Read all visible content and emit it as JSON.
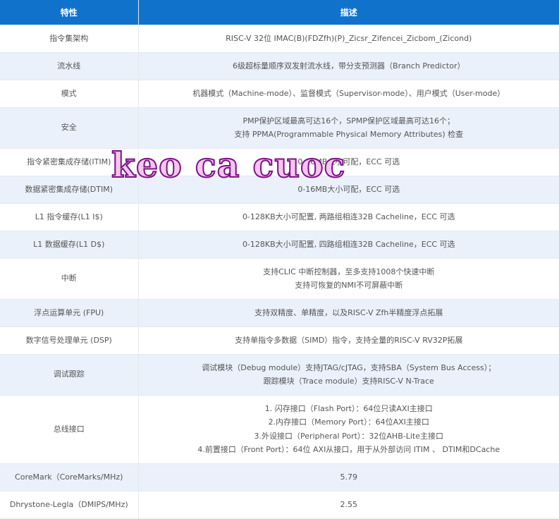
{
  "table": {
    "header": {
      "feature": "特性",
      "description": "描述"
    },
    "rows": [
      {
        "feature": "指令集架构",
        "lines": [
          "RISC-V 32位 IMAC(B)(FDZfh)(P)_Zicsr_Zifencei_Zicbom_(Zicond)"
        ]
      },
      {
        "feature": "流水线",
        "lines": [
          "6级超标量顺序双发射流水线，带分支预测器（Branch Predictor）"
        ]
      },
      {
        "feature": "模式",
        "lines": [
          "机器模式（Machine-mode）、监督模式（Supervisor-mode）、用户模式（User-mode）"
        ]
      },
      {
        "feature": "安全",
        "lines": [
          "PMP保护区域最高可达16个，SPMP保护区域最高可达16个；",
          "支持 PPMA(Programmable Physical Memory Attributes) 检查"
        ]
      },
      {
        "feature": "指令紧密集成存储(ITIM)",
        "lines": [
          "0-16MB大小可配，ECC 可选"
        ]
      },
      {
        "feature": "数据紧密集成存储(DTIM)",
        "lines": [
          "0-16MB大小可配，ECC 可选"
        ]
      },
      {
        "feature": "L1 指令缓存(L1 I$)",
        "lines": [
          "0-128KB大小可配置, 两路组相连32B Cacheline，ECC 可选"
        ]
      },
      {
        "feature": "L1 数据缓存(L1 D$)",
        "lines": [
          "0-128KB大小可配置, 四路组相连32B Cacheline，ECC 可选"
        ]
      },
      {
        "feature": "中断",
        "lines": [
          "支持CLIC 中断控制器，至多支持1008个快速中断",
          "支持可恢复的NMI不可屏蔽中断"
        ]
      },
      {
        "feature": "浮点运算单元 (FPU)",
        "lines": [
          "支持双精度、单精度，以及RISC-V Zfh半精度浮点拓展"
        ]
      },
      {
        "feature": "数字信号处理单元 (DSP)",
        "lines": [
          "支持单指令多数据（SIMD）指令，支持全量的RISC-V RV32P拓展"
        ]
      },
      {
        "feature": "调试跟踪",
        "lines": [
          "调试模块（Debug module）支持JTAG/cJTAG，支持SBA（System Bus Access）；",
          "跟踪模块（Trace module）支持RISC-V N-Trace"
        ]
      },
      {
        "feature": "总线接口",
        "lines": [
          "1. 闪存接口（Flash Port）：64位只读AXI主接口",
          "2.内存接口（Memory Port）：64位AXI主接口",
          "3.外设接口（Peripheral Port）：32位AHB-Lite主接口",
          "4.前置接口（Front Port）：64位 AXI从接口，用于从外部访问 ITIM 、 DTIM和DCache"
        ]
      },
      {
        "feature": "CoreMark（CoreMarks/MHz)",
        "lines": [
          "5.79"
        ]
      },
      {
        "feature": "Dhrystone-Legla（DMIPS/MHz)",
        "lines": [
          "2.55"
        ]
      }
    ]
  },
  "watermark": {
    "text": "keo ca cuoc"
  }
}
